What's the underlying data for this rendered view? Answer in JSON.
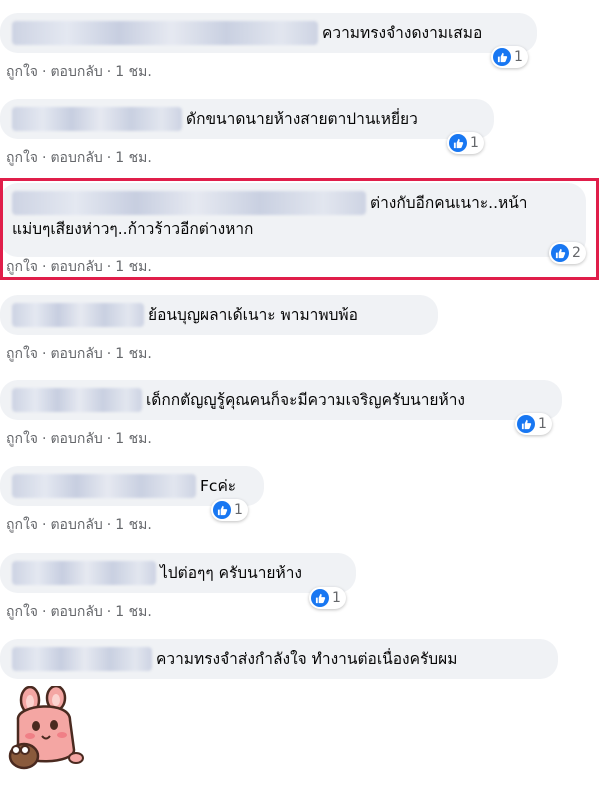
{
  "comments": [
    {
      "text": "ความทรงจำงดงามเสมอ",
      "like": "ถูกใจ",
      "reply": "ตอบกลับ",
      "time": "1 ชม.",
      "reactions": "1"
    },
    {
      "text": "ดักขนาดนายห้างสายตาปานเหยี่ยว",
      "like": "ถูกใจ",
      "reply": "ตอบกลับ",
      "time": "1 ชม.",
      "reactions": "1"
    },
    {
      "text_line1": "ต่างกับอีกคนเนาะ..หน้า",
      "text_line2": "แม่บๆเสียงห่าวๆ..ก้าวร้าวอีกต่างหาก",
      "like": "ถูกใจ",
      "reply": "ตอบกลับ",
      "time": "1 ชม.",
      "reactions": "2"
    },
    {
      "text": "ย้อนบุญผลาเด้เนาะ พามาพบพ้อ",
      "like": "ถูกใจ",
      "reply": "ตอบกลับ",
      "time": "1 ชม.",
      "reactions": ""
    },
    {
      "text": "เด็กกตัญญูรู้คุณคนก็จะมีความเจริญครับนายห้าง",
      "like": "ถูกใจ",
      "reply": "ตอบกลับ",
      "time": "1 ชม.",
      "reactions": "1"
    },
    {
      "text": "Fcค่ะ",
      "like": "ถูกใจ",
      "reply": "ตอบกลับ",
      "time": "1 ชม.",
      "reactions": "1"
    },
    {
      "text": "ไปต่อๆๆ ครับนายห้าง",
      "like": "ถูกใจ",
      "reply": "ตอบกลับ",
      "time": "1 ชม.",
      "reactions": "1"
    },
    {
      "text": "ความทรงจำส่งกำลังใจ ทำงานต่อเนื่องครับผม"
    }
  ],
  "colors": {
    "accent": "#1877f2",
    "highlight": "#e01e4a",
    "bubble": "#f0f2f5",
    "meta": "#65676b"
  },
  "icons": {
    "reaction": "thumbs-up-icon",
    "sticker": "pink-bunny-sticker"
  }
}
